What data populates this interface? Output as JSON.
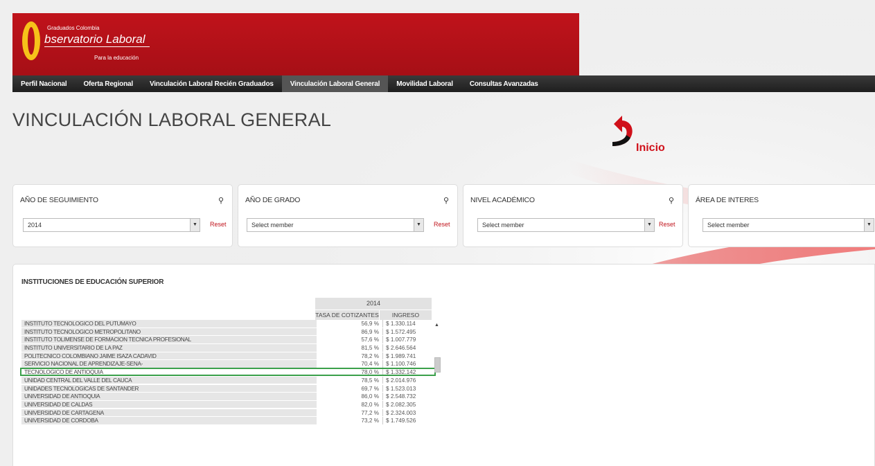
{
  "logo": {
    "small_text": "Graduados Colombia",
    "main_text": "bservatorio Laboral",
    "sub_text": "Para la educación"
  },
  "nav": {
    "items": [
      {
        "label": "Perfil Nacional",
        "active": false
      },
      {
        "label": "Oferta Regional",
        "active": false
      },
      {
        "label": "Vinculación Laboral Recién Graduados",
        "active": false
      },
      {
        "label": "Vinculación Laboral General",
        "active": true
      },
      {
        "label": "Movilidad Laboral",
        "active": false
      },
      {
        "label": "Consultas Avanzadas",
        "active": false
      }
    ]
  },
  "page": {
    "title": "VINCULACIÓN LABORAL GENERAL",
    "home_label": "Inicio"
  },
  "filters": [
    {
      "title": "AÑO DE SEGUIMIENTO",
      "value": "2014",
      "reset": "Reset"
    },
    {
      "title": "AÑO DE GRADO",
      "value": "Select member",
      "reset": "Reset"
    },
    {
      "title": "NIVEL ACADÉMICO",
      "value": "Select member",
      "reset": "Reset"
    },
    {
      "title": "ÁREA DE INTERES",
      "value": "Select member",
      "reset": ""
    }
  ],
  "institutions": {
    "title": "INSTITUCIONES DE EDUCACIÓN SUPERIOR",
    "year": "2014",
    "col_rate": "TASA DE COTIZANTES",
    "col_income": "INGRESO",
    "rows": [
      {
        "name": "INSTITUTO TECNOLOGICO DEL PUTUMAYO",
        "rate": "56,9 %",
        "income": "$ 1.330.114"
      },
      {
        "name": "INSTITUTO TECNOLOGICO METROPOLITANO",
        "rate": "86,9 %",
        "income": "$ 1.572.495"
      },
      {
        "name": "INSTITUTO TOLIMENSE DE FORMACION TECNICA PROFESIONAL",
        "rate": "57,6 %",
        "income": "$ 1.007.779"
      },
      {
        "name": "INSTITUTO UNIVERSITARIO DE LA PAZ",
        "rate": "81,5 %",
        "income": "$ 2.646.564"
      },
      {
        "name": "POLITECNICO COLOMBIANO JAIME ISAZA CADAVID",
        "rate": "78,2 %",
        "income": "$ 1.989.741"
      },
      {
        "name": "SERVICIO NACIONAL DE APRENDIZAJE-SENA-",
        "rate": "70,4 %",
        "income": "$ 1.100.746"
      },
      {
        "name": "TECNOLOGICO DE ANTIOQUIA",
        "rate": "78,0 %",
        "income": "$ 1.332.142",
        "highlight": true
      },
      {
        "name": "UNIDAD CENTRAL DEL VALLE DEL CAUCA",
        "rate": "78,5 %",
        "income": "$ 2.014.976"
      },
      {
        "name": "UNIDADES TECNOLOGICAS DE SANTANDER",
        "rate": "69,7 %",
        "income": "$ 1.523.013"
      },
      {
        "name": "UNIVERSIDAD DE ANTIOQUIA",
        "rate": "86,0 %",
        "income": "$ 2.548.732"
      },
      {
        "name": "UNIVERSIDAD DE CALDAS",
        "rate": "82,0 %",
        "income": "$ 2.082.305"
      },
      {
        "name": "UNIVERSIDAD DE CARTAGENA",
        "rate": "77,2 %",
        "income": "$ 2.324.003"
      },
      {
        "name": "UNIVERSIDAD DE CORDOBA",
        "rate": "73,2 %",
        "income": "$ 1.749.526"
      }
    ]
  },
  "colors": {
    "brand_red": "#c0131b",
    "logo_yellow": "#f6c21a",
    "highlight_green": "#3aa04a",
    "nav_dark": "#2a2a2a"
  }
}
